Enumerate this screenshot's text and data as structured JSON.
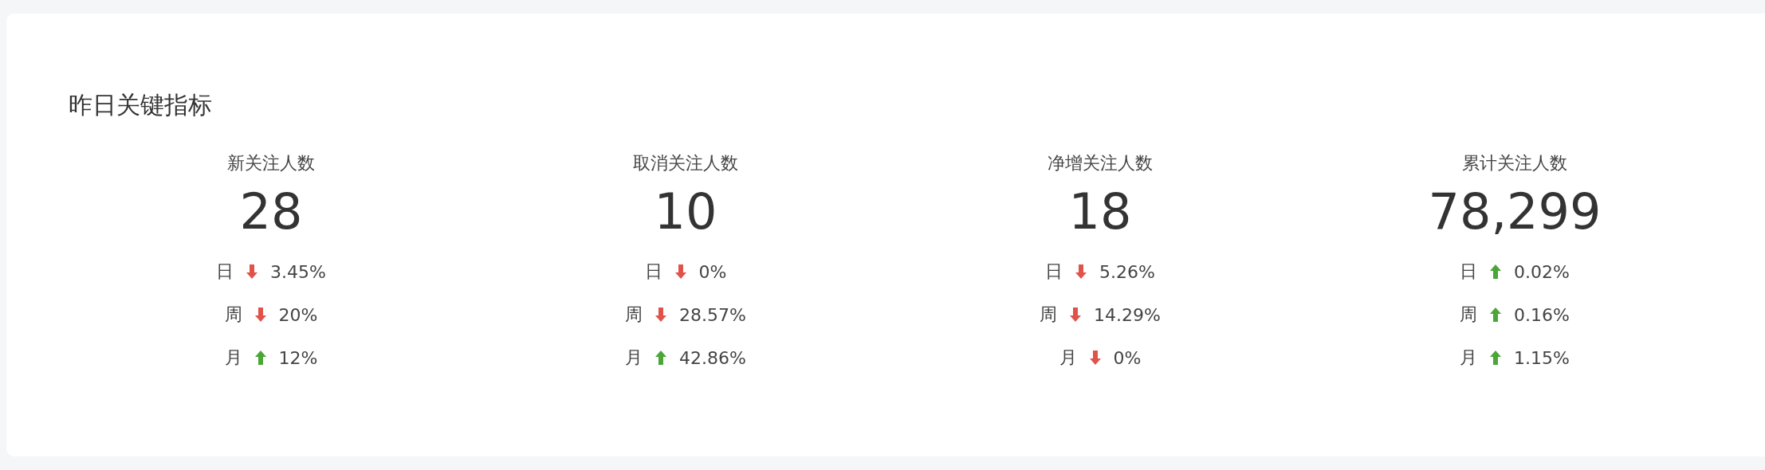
{
  "card": {
    "title": "昨日关键指标"
  },
  "metrics": [
    {
      "label": "新关注人数",
      "value": "28",
      "changes": [
        {
          "period": "日",
          "kind": "down",
          "percent": "3.45%"
        },
        {
          "period": "周",
          "kind": "down",
          "percent": "20%"
        },
        {
          "period": "月",
          "kind": "up",
          "percent": "12%"
        }
      ]
    },
    {
      "label": "取消关注人数",
      "value": "10",
      "changes": [
        {
          "period": "日",
          "kind": "down",
          "percent": "0%"
        },
        {
          "period": "周",
          "kind": "down",
          "percent": "28.57%"
        },
        {
          "period": "月",
          "kind": "up",
          "percent": "42.86%"
        }
      ]
    },
    {
      "label": "净增关注人数",
      "value": "18",
      "changes": [
        {
          "period": "日",
          "kind": "down",
          "percent": "5.26%"
        },
        {
          "period": "周",
          "kind": "down",
          "percent": "14.29%"
        },
        {
          "period": "月",
          "kind": "down",
          "percent": "0%"
        }
      ]
    },
    {
      "label": "累计关注人数",
      "value": "78,299",
      "changes": [
        {
          "period": "日",
          "kind": "up",
          "percent": "0.02%"
        },
        {
          "period": "周",
          "kind": "up",
          "percent": "0.16%"
        },
        {
          "period": "月",
          "kind": "up",
          "percent": "1.15%"
        }
      ]
    }
  ]
}
